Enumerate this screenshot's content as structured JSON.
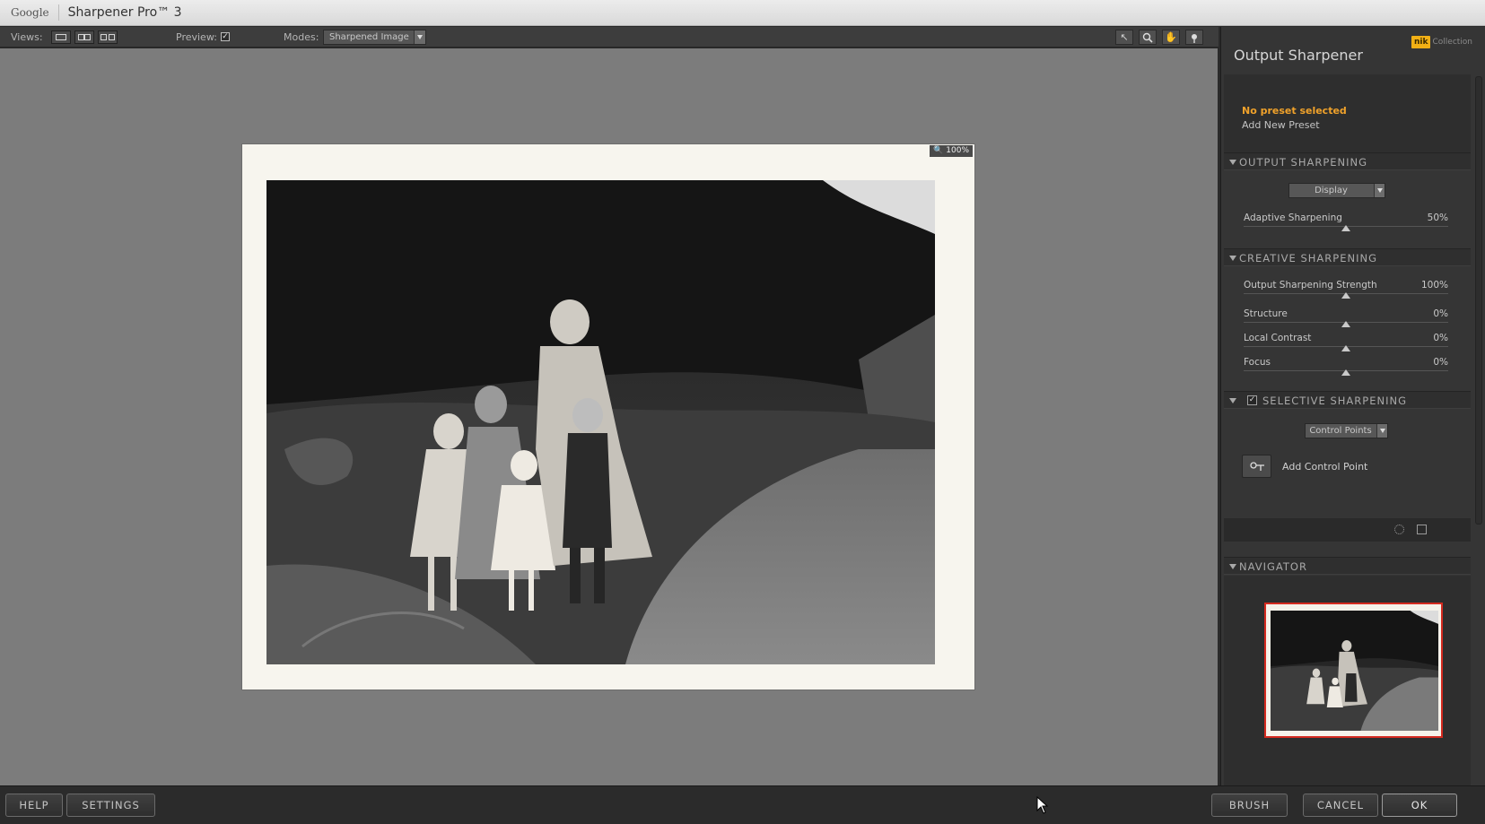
{
  "titlebar": {
    "brand": "Google",
    "app_name": "Sharpener Pro™ 3"
  },
  "toolbar": {
    "views_label": "Views:",
    "preview_label": "Preview:",
    "preview_checked": "✓",
    "modes_label": "Modes:",
    "modes_value": "Sharpened Image",
    "tools": [
      "pointer-icon",
      "zoom-icon",
      "hand-icon",
      "control-point-icon"
    ]
  },
  "canvas": {
    "zoom": "100%",
    "zoom_icon": "🔍"
  },
  "panel": {
    "title": "Output Sharpener",
    "logo_mark": "nik",
    "logo_text": "Collection",
    "preset_none": "No preset selected",
    "preset_add": "Add New Preset",
    "output_sharpening": {
      "header": "OUTPUT SHARPENING",
      "select_value": "Display",
      "adaptive_label": "Adaptive Sharpening",
      "adaptive_value": "50%",
      "adaptive_level": 0.5
    },
    "creative_sharpening": {
      "header": "CREATIVE SHARPENING",
      "sliders": [
        {
          "label": "Output Sharpening Strength",
          "value": "100%",
          "level": 0.5
        },
        {
          "label": "Structure",
          "value": "0%",
          "level": 0.5
        },
        {
          "label": "Local Contrast",
          "value": "0%",
          "level": 0.5
        },
        {
          "label": "Focus",
          "value": "0%",
          "level": 0.5
        }
      ]
    },
    "selective_sharpening": {
      "header": "SELECTIVE SHARPENING",
      "checked": "✓",
      "select_value": "Control Points",
      "add_control_point": "Add Control Point"
    },
    "navigator": {
      "header": "NAVIGATOR"
    }
  },
  "buttons": {
    "help": "HELP",
    "settings": "SETTINGS",
    "brush": "BRUSH",
    "cancel": "CANCEL",
    "ok": "OK"
  },
  "colors": {
    "accent_orange": "#f0a22b",
    "navigator_border": "#d42a1f",
    "nik_yellow": "#f2b015"
  }
}
